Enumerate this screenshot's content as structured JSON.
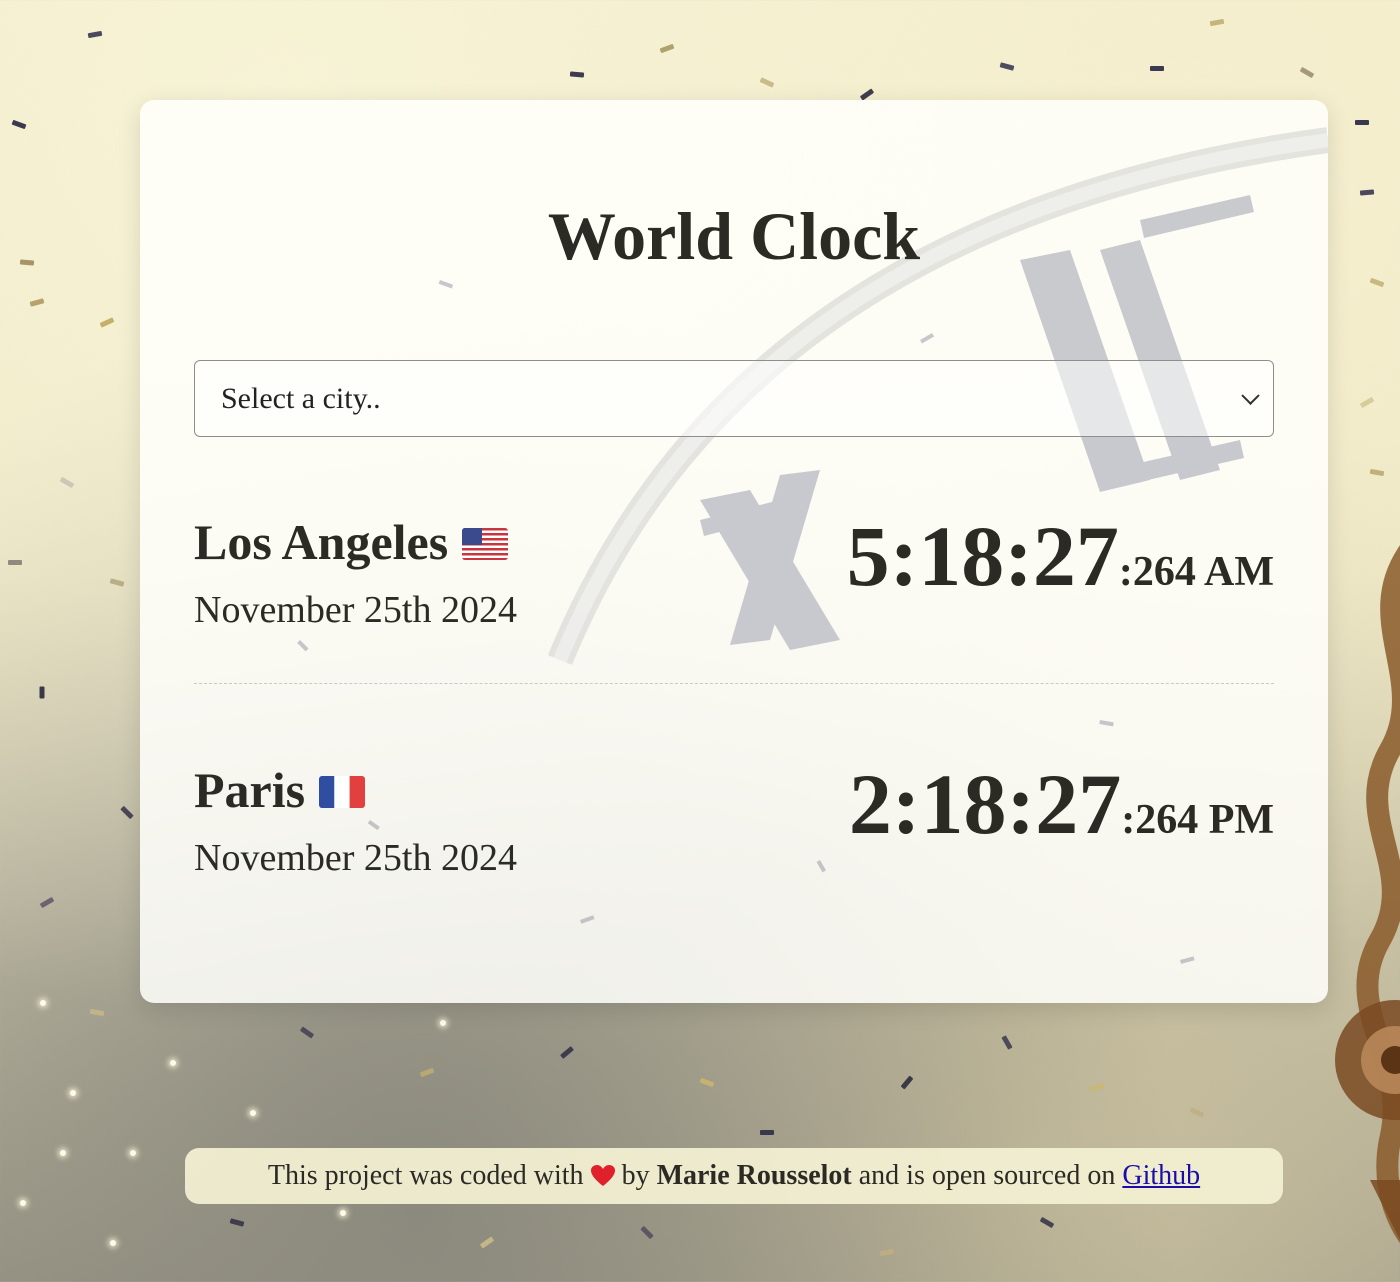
{
  "app": {
    "title": "World Clock"
  },
  "city_select": {
    "value": "Select a city..",
    "icon": "chevron-down-icon"
  },
  "cities": [
    {
      "name": "Los Angeles",
      "flag": "us-flag-icon",
      "date": "November 25th 2024",
      "time_main": "5:18:27",
      "time_suffix": ":264 AM"
    },
    {
      "name": "Paris",
      "flag": "france-flag-icon",
      "date": "November 25th 2024",
      "time_main": "2:18:27",
      "time_suffix": ":264 PM"
    }
  ],
  "footer": {
    "text_before": "This project was coded with",
    "heart_icon": "heart-icon",
    "text_by": "by",
    "author": "Marie Rousselot",
    "text_after": "and is open sourced on",
    "link_label": "Github"
  },
  "colors": {
    "text": "#2b2a24",
    "link": "#1a0dab",
    "heart": "#e0202a"
  }
}
